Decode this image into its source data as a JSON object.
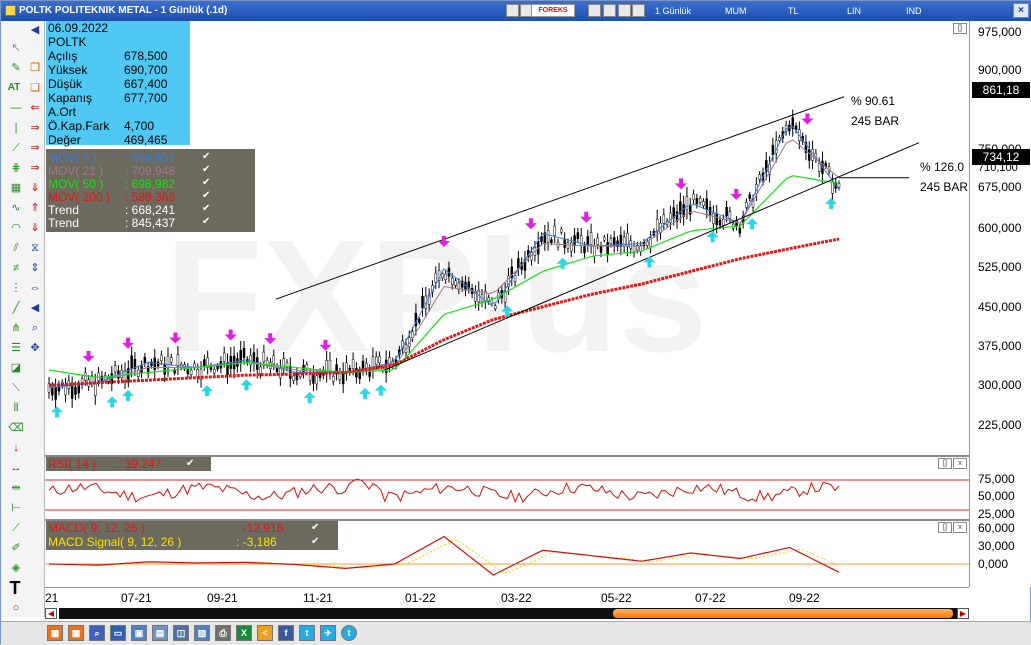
{
  "window": {
    "title": "POLTK POLITEKNIK METAL - 1 Günlük (.1d)",
    "brand": "FOREKS",
    "period": "1 Günlük",
    "chart_style": "MUM",
    "currency": "TL",
    "scale": "LIN",
    "indicator": "IND",
    "close_glyph": "×",
    "small_btn": "[]",
    "close_small": "x"
  },
  "info": {
    "date": "06.09.2022",
    "symbol": "POLTK",
    "rows": [
      {
        "label": "Açılış",
        "value": "678,500"
      },
      {
        "label": "Yüksek",
        "value": "690,700"
      },
      {
        "label": "Düşük",
        "value": "667,400"
      },
      {
        "label": "Kapanış",
        "value": "677,700"
      },
      {
        "label": "A.Ort",
        "value": ""
      },
      {
        "label": "Ö.Kap.Fark",
        "value": "4,700"
      },
      {
        "label": "Değer",
        "value": "469,465"
      }
    ]
  },
  "mov": {
    "rows": [
      {
        "label": "MOV( 5 )",
        "value": ": 686,851",
        "color": "#3a7de0"
      },
      {
        "label": "MOV( 21 )",
        "value": ": 709,948",
        "color": "#a07888"
      },
      {
        "label": "MOV( 50 )",
        "value": ": 698,982",
        "color": "#19e019"
      },
      {
        "label": "MOV( 200 )",
        "value": ": 589,368",
        "color": "#e01818"
      },
      {
        "label": "Trend",
        "value": ": 668,241",
        "color": "#ffffff"
      },
      {
        "label": "Trend",
        "value": ": 845,437",
        "color": "#ffffff"
      }
    ]
  },
  "rsi": {
    "label": "RSI( 14 )",
    "value": ": 39,247"
  },
  "macd": {
    "label": "MACD( 9, 12, 26 )",
    "value": ": -12,916",
    "signal_label": "MACD Signal( 9, 12, 26 )",
    "signal_value": ": -3,186"
  },
  "annotations": {
    "upper_pct": "% 90.61",
    "upper_bar": "245 BAR",
    "lower_pct": "% 126.0",
    "lower_bar": "245 BAR"
  },
  "watermark": "FXPlus",
  "colors": {
    "mov5": "#3a7de0",
    "mov21": "#a07888",
    "mov50": "#19e019",
    "mov200": "#e01818",
    "buy_arrow": "#27d6e8",
    "sell_arrow": "#e020e0",
    "info_bg": "#4fc9f4",
    "panel_bg": "#6b6a5c"
  },
  "price_axis": {
    "ticks": [
      "975,000",
      "900,000",
      "750,000",
      "675,000",
      "600,000",
      "525,000",
      "450,000",
      "375,000",
      "300,000",
      "225,000"
    ],
    "last_price": "734,12",
    "high_marker": "861,18",
    "current_price": "710,100"
  },
  "rsi_axis": {
    "ticks": [
      "75,000",
      "50,000",
      "25,000"
    ]
  },
  "macd_axis": {
    "ticks": [
      "60,000",
      "30,000",
      "0,000"
    ]
  },
  "x_axis": {
    "ticks": [
      "21",
      "07-21",
      "09-21",
      "11-21",
      "01-22",
      "03-22",
      "05-22",
      "07-22",
      "09-22"
    ]
  },
  "chart_data": {
    "type": "line",
    "title": "POLTK POLITEKNIK METAL - 1 Günlük (.1d)",
    "x": [
      "2021-05",
      "2021-06",
      "2021-07",
      "2021-08",
      "2021-09",
      "2021-10",
      "2021-11",
      "2021-12",
      "2022-01",
      "2022-02",
      "2022-03",
      "2022-04",
      "2022-05",
      "2022-06",
      "2022-07",
      "2022-08",
      "2022-09"
    ],
    "series": [
      {
        "name": "MOV( 5 )",
        "values": [
          295,
          305,
          345,
          335,
          350,
          325,
          325,
          345,
          530,
          455,
          600,
          575,
          580,
          660,
          620,
          820,
          687
        ]
      },
      {
        "name": "MOV( 21 )",
        "values": [
          300,
          305,
          335,
          335,
          345,
          330,
          325,
          335,
          495,
          480,
          580,
          575,
          575,
          645,
          620,
          790,
          710
        ]
      },
      {
        "name": "MOV( 50 )",
        "values": [
          330,
          315,
          325,
          335,
          345,
          335,
          325,
          330,
          440,
          470,
          525,
          555,
          565,
          605,
          615,
          715,
          699
        ]
      },
      {
        "name": "MOV( 200 )",
        "values": [
          300,
          305,
          310,
          315,
          320,
          322,
          325,
          340,
          390,
          430,
          455,
          480,
          500,
          525,
          550,
          570,
          589
        ]
      }
    ],
    "ylim": [
      170,
      1000
    ],
    "grid": false,
    "trend_channel": {
      "upper": [
        [
          "2021-10",
          470
        ],
        [
          "2022-09",
          870
        ]
      ],
      "lower": [
        [
          "2021-12",
          330
        ],
        [
          "2022-09",
          720
        ]
      ]
    }
  }
}
